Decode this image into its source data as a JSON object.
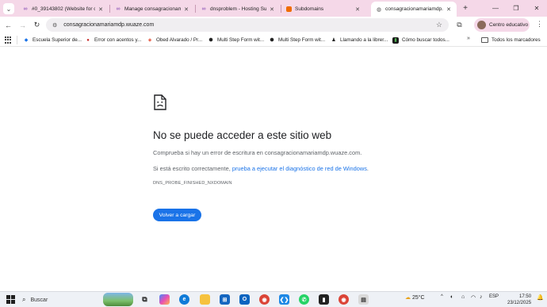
{
  "tabs": [
    {
      "title": "#0_39143802 (Website for c...",
      "favicon": "link-icon",
      "active": false
    },
    {
      "title": "Manage consagracionamariar...",
      "favicon": "link-icon",
      "active": false
    },
    {
      "title": "dnsproblem - Hosting Suppo...",
      "favicon": "link-icon",
      "active": false
    },
    {
      "title": "Subdomains",
      "favicon": "orange-square-icon",
      "active": false
    },
    {
      "title": "consagracionamariamdp.wuaz...",
      "favicon": "globe-icon",
      "active": true
    }
  ],
  "toolbar": {
    "url": "consagracionamariamdp.wuaze.com",
    "profile_label": "Centro educativo"
  },
  "bookmarks": [
    {
      "label": "Escuela Superior de...",
      "icon": "lens-icon",
      "color": "#1a73e8"
    },
    {
      "label": "Error con acentos y...",
      "icon": "circle-red-icon",
      "color": "#c62828"
    },
    {
      "label": "Obed Alvarado / Pr...",
      "icon": "gitlab-icon",
      "color": "#e2432a"
    },
    {
      "label": "Multi Step Form wit...",
      "icon": "codepen-icon",
      "color": "#222222"
    },
    {
      "label": "Multi Step Form wit...",
      "icon": "codepen-icon",
      "color": "#222222"
    },
    {
      "label": "Llamando a la librer...",
      "icon": "person-icon",
      "color": "#222222"
    },
    {
      "label": "Cómo buscar todos...",
      "icon": "terminal-icon",
      "color": "#2e7d32"
    }
  ],
  "bookmarks_more": "»",
  "all_bookmarks": "Todos los marcadores",
  "error": {
    "title": "No se puede acceder a este sitio web",
    "line1": "Comprueba si hay un error de escritura en consagracionamariamdp.wuaze.com.",
    "line2_prefix": "Si está escrito correctamente, ",
    "line2_link": "prueba a ejecutar el diagnóstico de red de Windows",
    "line2_suffix": ".",
    "code": "DNS_PROBE_FINISHED_NXDOMAIN",
    "reload": "Volver a cargar"
  },
  "taskbar": {
    "search": "Buscar",
    "temperature": "25°C",
    "language": "ESP",
    "time": "17:50",
    "date": "23/12/2025"
  },
  "colors": {
    "tabstrip": "#f5d8e8",
    "accent": "#1a73e8"
  }
}
